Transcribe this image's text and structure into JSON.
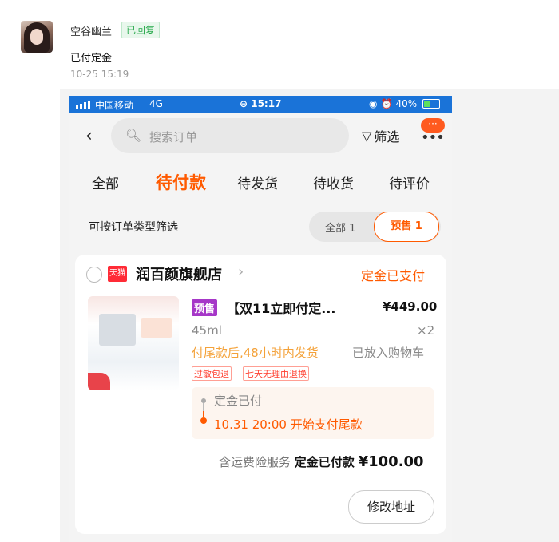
{
  "chat": {
    "sender": "空谷幽兰",
    "reply_badge": "已回复",
    "message": "已付定金",
    "time": "10-25 15:19"
  },
  "statusbar": {
    "carrier": "中国移动",
    "network": "4G",
    "time": "15:17",
    "battery": "40%"
  },
  "search": {
    "placeholder": "搜索订单",
    "filter_label": "筛选",
    "more_badge": "···"
  },
  "tabs": [
    {
      "label": "全部"
    },
    {
      "label": "待付款",
      "active": true
    },
    {
      "label": "待发货"
    },
    {
      "label": "待收货"
    },
    {
      "label": "待评价"
    }
  ],
  "type_filter": {
    "hint": "可按订单类型筛选",
    "all_label": "全部 1",
    "sale_label": "预售 1"
  },
  "order": {
    "platform_badge": "天猫",
    "shop_name": "润百颜旗舰店",
    "status": "定金已支付",
    "presale_tag": "预售",
    "product_name": "【双11立即付定...",
    "price": "¥449.00",
    "spec": "45ml",
    "quantity": "×2",
    "shipping_note": "付尾款后,48小时内发货",
    "cart_note": "已放入购物车",
    "service_badges": [
      "过敏包退",
      "七天无理由退换"
    ],
    "step_deposit": "定金已付",
    "step_final": "10.31 20:00 开始支付尾款",
    "summary_prefix": "含运费险服务",
    "summary_paid_label": "定金已付款",
    "summary_amount": "¥100.00",
    "modify_address_label": "修改地址"
  },
  "colors": {
    "accent": "#ff5a00",
    "statusbar": "#1a73d8",
    "presale": "#a637c8"
  }
}
